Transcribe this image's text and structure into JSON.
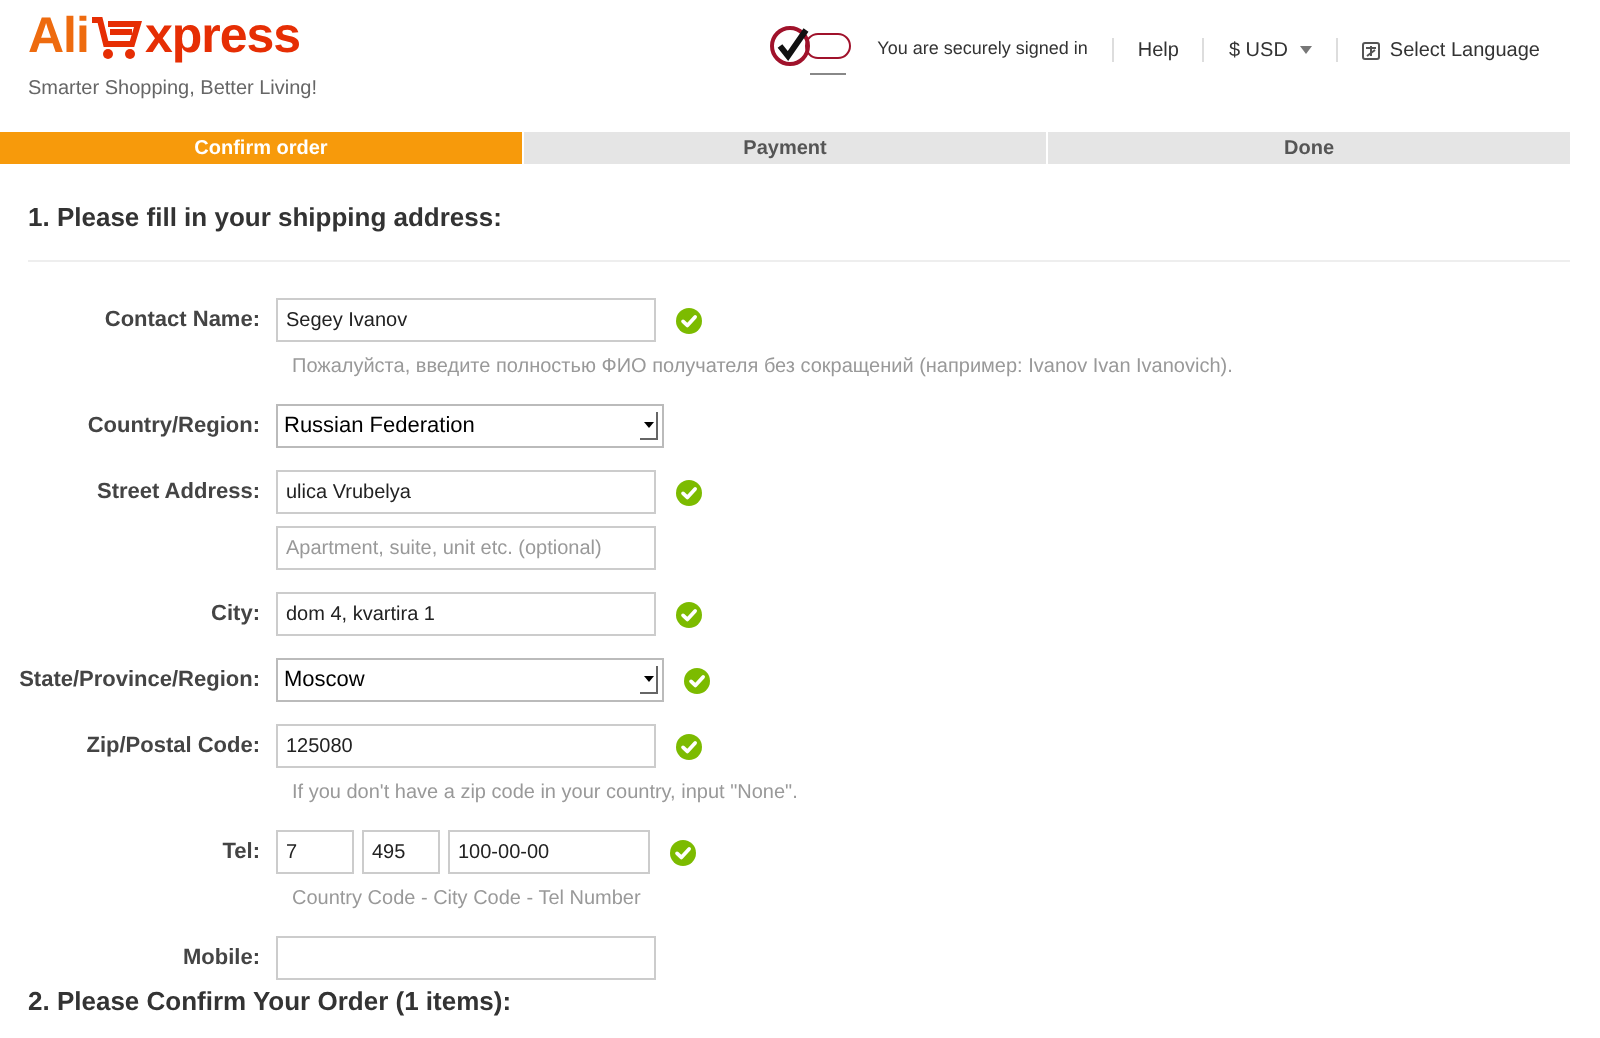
{
  "header": {
    "logo": {
      "part_1": "Ali",
      "part_2": "xpress"
    },
    "tagline": "Smarter Shopping, Better Living!",
    "secure_text": "You are securely signed in",
    "nav": [
      {
        "kind": "link",
        "label": "Help"
      },
      {
        "kind": "dropdown",
        "label": "$ USD"
      },
      {
        "kind": "language",
        "label": "Select Language"
      }
    ]
  },
  "steps": [
    {
      "label": "Confirm order",
      "selected": true
    },
    {
      "label": "Payment",
      "selected": false
    },
    {
      "label": "Done",
      "selected": false
    }
  ],
  "section_title": "1. Please fill in your shipping address:",
  "fields": [
    {
      "kind": "text",
      "label": "Contact Name:",
      "inputs": [
        {
          "value": "Segey Ivanov"
        }
      ],
      "valid": true,
      "hint": "Пожалуйста, введите полностью ФИО получателя без сокращений (например: Ivanov Ivan Ivanovich)."
    },
    {
      "kind": "select",
      "label": "Country/Region:",
      "inputs": [
        {
          "value": "Russian Federation"
        }
      ],
      "valid": false
    },
    {
      "kind": "text",
      "label": "Street Address:",
      "inputs": [
        {
          "value": "ulica Vrubelya"
        },
        {
          "placeholder": "Apartment, suite, unit etc. (optional)"
        }
      ],
      "valid": true
    },
    {
      "kind": "text",
      "label": "City:",
      "inputs": [
        {
          "value": "dom 4, kvartira 1"
        }
      ],
      "valid": true
    },
    {
      "kind": "select",
      "label": "State/Province/Region:",
      "inputs": [
        {
          "value": "Moscow"
        }
      ],
      "valid": true
    },
    {
      "kind": "text",
      "label": "Zip/Postal Code:",
      "inputs": [
        {
          "value": "125080"
        }
      ],
      "valid": true,
      "hint": "If you don't have a zip code in your country, input \"None\"."
    },
    {
      "kind": "phone",
      "label": "Tel:",
      "inputs": [
        {
          "value": "7"
        },
        {
          "value": "495"
        },
        {
          "value": "100-00-00"
        }
      ],
      "valid": true,
      "hint": "Country Code - City Code - Tel Number"
    },
    {
      "kind": "text",
      "label": "Mobile:",
      "valid": false
    }
  ],
  "next_section_title": "2. Please Confirm Your Order (1 items):"
}
